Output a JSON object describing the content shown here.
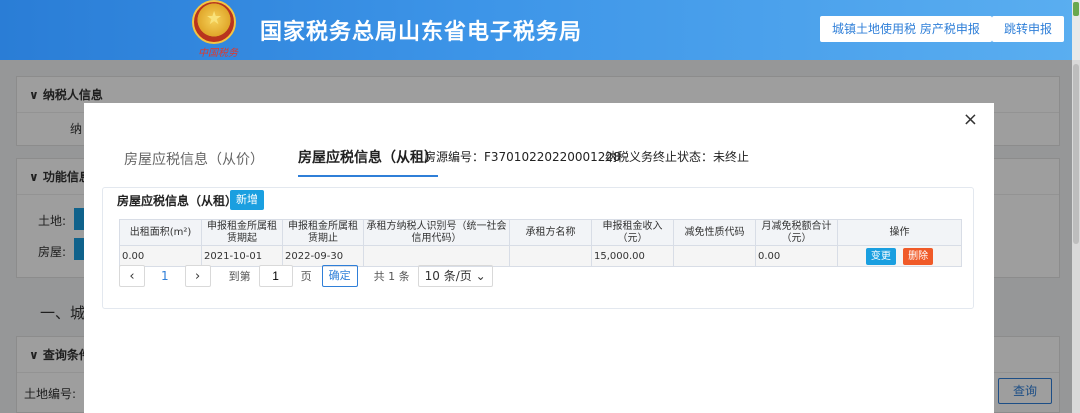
{
  "header": {
    "title": "国家税务总局山东省电子税务局",
    "seal_text": "中国税务",
    "buttons": [
      "城镇土地使用税 房产税申报",
      "跳转申报"
    ]
  },
  "background": {
    "section1_title": "纳税人信息",
    "section1_label": "纳",
    "section2_title": "功能信息",
    "label_land": "土地:",
    "label_house": "房屋:",
    "section3_heading": "一、城",
    "section4_title": "查询条件",
    "land_number_label": "土地编号:",
    "query_button": "查询"
  },
  "modal": {
    "close_symbol": "×",
    "tabs": [
      "房屋应税信息（从价）",
      "房屋应税信息（从租）"
    ],
    "active_tab": 1,
    "source_no": "房源编号：F37010220220001228",
    "tax_status": "纳税义务终止状态：未终止",
    "panel_title": "房屋应税信息（从租）",
    "new_button": "新增",
    "table": {
      "columns": [
        "出租面积(m²)",
        "申报租金所属租赁期起",
        "申报租金所属租赁期止",
        "承租方纳税人识别号（统一社会信用代码）",
        "承租方名称",
        "申报租金收入（元）",
        "减免性质代码",
        "月减免税额合计（元）",
        "操作"
      ],
      "rows": [
        [
          "0.00",
          "2021-10-01",
          "2022-09-30",
          "",
          "",
          "15,000.00",
          "",
          "0.00"
        ]
      ],
      "edit_label": "变更",
      "delete_label": "删除"
    },
    "pager": {
      "prev": "‹",
      "next": "›",
      "current": "1",
      "goto_label": "到第",
      "goto_value": "1",
      "page_unit": "页",
      "confirm": "确定",
      "total": "共 1 条",
      "page_size": "10 条/页"
    }
  }
}
